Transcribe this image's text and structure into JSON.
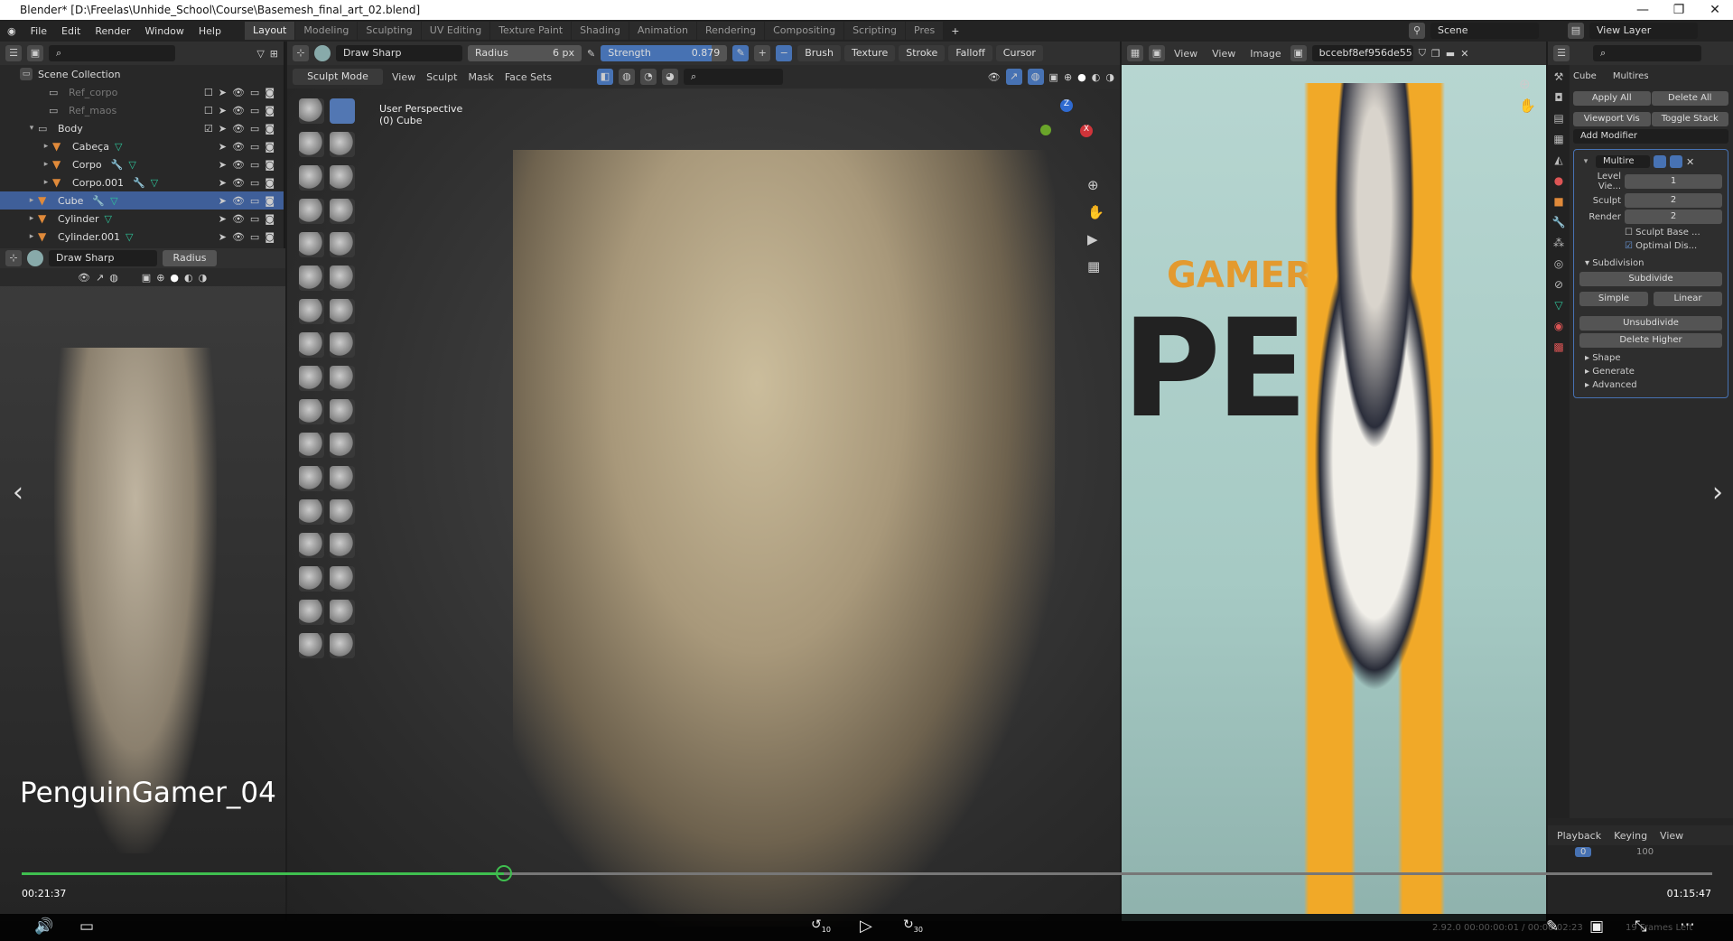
{
  "window": {
    "title": "Blender* [D:\\Freelas\\Unhide_School\\Course\\Basemesh_final_art_02.blend]",
    "minimize": "—",
    "restore": "❐",
    "close": "✕"
  },
  "menus": [
    "File",
    "Edit",
    "Render",
    "Window",
    "Help"
  ],
  "workspaces": [
    "Layout",
    "Modeling",
    "Sculpting",
    "UV Editing",
    "Texture Paint",
    "Shading",
    "Animation",
    "Rendering",
    "Compositing",
    "Scripting",
    "Pres"
  ],
  "scene": {
    "scene_name": "Scene",
    "view_layer": "View Layer"
  },
  "outliner": {
    "root": "Scene Collection",
    "items": [
      {
        "name": "Ref_corpo",
        "dim": true,
        "checkbox": "☐"
      },
      {
        "name": "Ref_maos",
        "dim": true,
        "checkbox": "☐"
      },
      {
        "name": "Body",
        "checkbox": "☑"
      },
      {
        "name": "Cabeça"
      },
      {
        "name": "Corpo",
        "modifier": true
      },
      {
        "name": "Corpo.001",
        "modifier": true
      },
      {
        "name": "Cube",
        "modifier": true,
        "selected": true
      },
      {
        "name": "Cylinder"
      },
      {
        "name": "Cylinder.001"
      }
    ]
  },
  "left_view": {
    "brush": "Draw Sharp",
    "radius_label": "Radius"
  },
  "sculpt_header": {
    "brush": "Draw Sharp",
    "radius_label": "Radius",
    "radius_value": "6 px",
    "strength_label": "Strength",
    "strength_value": "0.879",
    "strength_fraction": 0.879,
    "menus": [
      "Brush",
      "Texture",
      "Stroke",
      "Falloff",
      "Cursor"
    ],
    "mode": "Sculpt Mode",
    "mode_menus": [
      "View",
      "Sculpt",
      "Mask",
      "Face Sets"
    ]
  },
  "viewport": {
    "perspective": "User Perspective",
    "object": "(0) Cube",
    "axis_x": "X",
    "axis_y": "Y",
    "axis_z": "Z"
  },
  "image_editor": {
    "menus": [
      "View",
      "View",
      "Image"
    ],
    "image_name": "bccebf8ef956de55...",
    "art_text": [
      "GAMER",
      "PEN"
    ]
  },
  "properties": {
    "object": "Cube",
    "modifier_tab": "Multires",
    "apply_all": "Apply All",
    "delete_all": "Delete All",
    "viewport_vis": "Viewport Vis",
    "toggle_stack": "Toggle Stack",
    "add_modifier": "Add Modifier",
    "modifier_name": "Multire",
    "fields": [
      {
        "label": "Level Vie...",
        "value": "1"
      },
      {
        "label": "Sculpt",
        "value": "2"
      },
      {
        "label": "Render",
        "value": "2"
      }
    ],
    "sculpt_base": "Sculpt Base ...",
    "optimal_display": "Optimal Dis...",
    "subdivision": "Subdivision",
    "subdivide": "Subdivide",
    "simple": "Simple",
    "linear": "Linear",
    "unsubdivide": "Unsubdivide",
    "delete_higher": "Delete Higher",
    "panels": [
      "Shape",
      "Generate",
      "Advanced"
    ]
  },
  "timeline": {
    "menus": [
      "Playback",
      "Keying",
      "View"
    ],
    "current_frame": "0",
    "end_frame": "100"
  },
  "video": {
    "title": "PenguinGamer_04",
    "elapsed": "00:21:37",
    "total": "01:15:47",
    "progress": 0.285,
    "rewind": "10",
    "forward": "30",
    "status": "2.92.0   00:00:00:01 / 00:00:02:23",
    "frames_left": "19 Frames Left",
    "accent": "#3fbf4f"
  }
}
